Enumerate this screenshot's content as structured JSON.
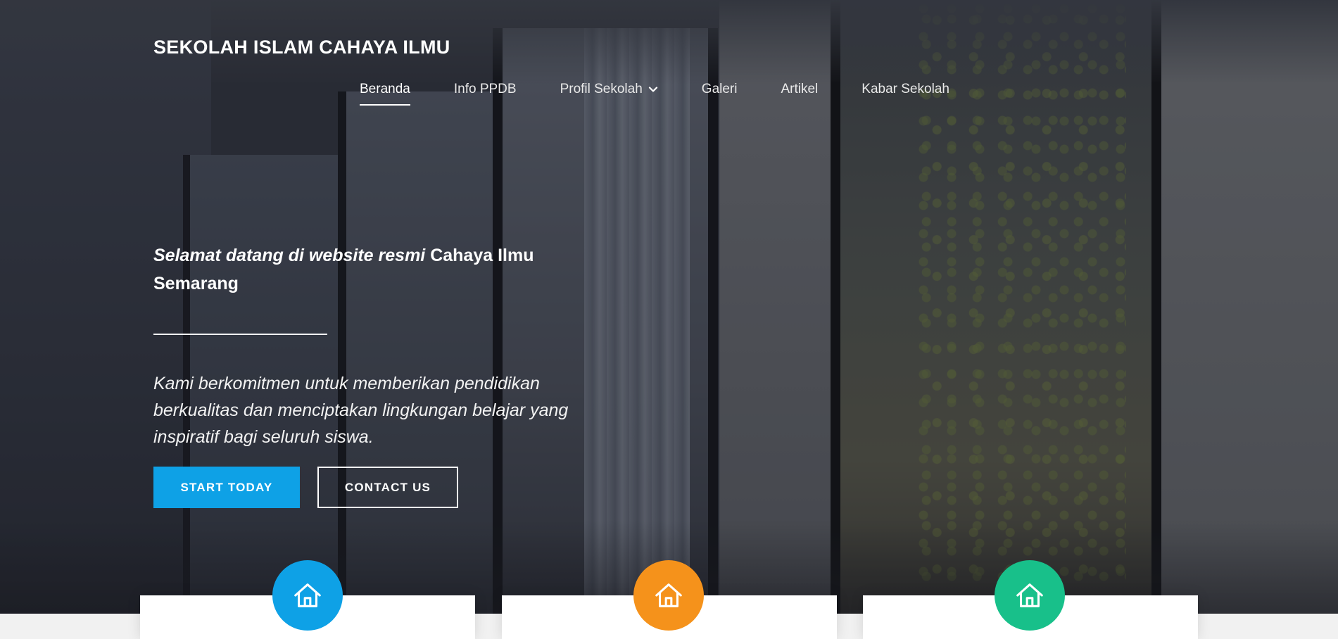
{
  "brand": {
    "name": "SEKOLAH ISLAM CAHAYA ILMU"
  },
  "nav": {
    "items": [
      {
        "label": "Beranda",
        "active": true
      },
      {
        "label": "Info PPDB"
      },
      {
        "label": "Profil Sekolah",
        "icon": "chevron-down-icon"
      },
      {
        "label": "Galeri"
      },
      {
        "label": "Artikel"
      },
      {
        "label": "Kabar Sekolah"
      }
    ]
  },
  "hero": {
    "title_italic": "Selamat datang di website resmi",
    "title_rest": " Cahaya Ilmu Semarang",
    "description": "Kami berkomitmen untuk memberikan pendidikan berkualitas dan menciptakan lingkungan belajar yang inspiratif bagi seluruh siswa.",
    "primary_button": "START TODAY",
    "secondary_button": "CONTACT US"
  },
  "features": [
    {
      "icon": "home-icon",
      "color": "#0ea1e6"
    },
    {
      "icon": "home-icon",
      "color": "#f5921b"
    },
    {
      "icon": "home-icon",
      "color": "#18c08a"
    }
  ],
  "colors": {
    "accent": "#0ea1e6",
    "orange": "#f5921b",
    "green": "#18c08a"
  }
}
